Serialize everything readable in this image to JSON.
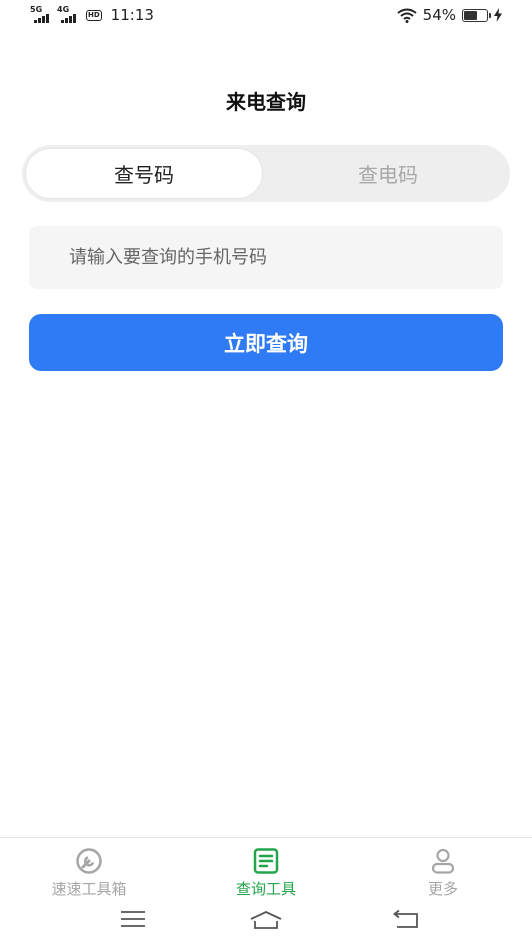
{
  "status_bar": {
    "sim1_tag": "5G",
    "sim2_tag": "4G",
    "hd_tag": "HD",
    "time": "11:13",
    "battery_text": "54%",
    "battery_level": 0.54
  },
  "header": {
    "title": "来电查询"
  },
  "tabs": [
    {
      "label": "查号码",
      "active": true
    },
    {
      "label": "查电码",
      "active": false
    }
  ],
  "search": {
    "placeholder": "请输入要查询的手机号码",
    "value": ""
  },
  "submit": {
    "label": "立即查询"
  },
  "bottom_nav": [
    {
      "label": "速速工具箱",
      "icon": "wrench-icon",
      "active": false
    },
    {
      "label": "查询工具",
      "icon": "document-icon",
      "active": true
    },
    {
      "label": "更多",
      "icon": "person-icon",
      "active": false
    }
  ],
  "colors": {
    "primary_button": "#2f7bf6",
    "active_nav": "#22a54a",
    "inactive_nav": "#a6a6a6",
    "segment_bg": "#eeeeee"
  },
  "system_nav": {
    "icons": [
      "menu-icon",
      "home-icon",
      "back-icon"
    ]
  }
}
